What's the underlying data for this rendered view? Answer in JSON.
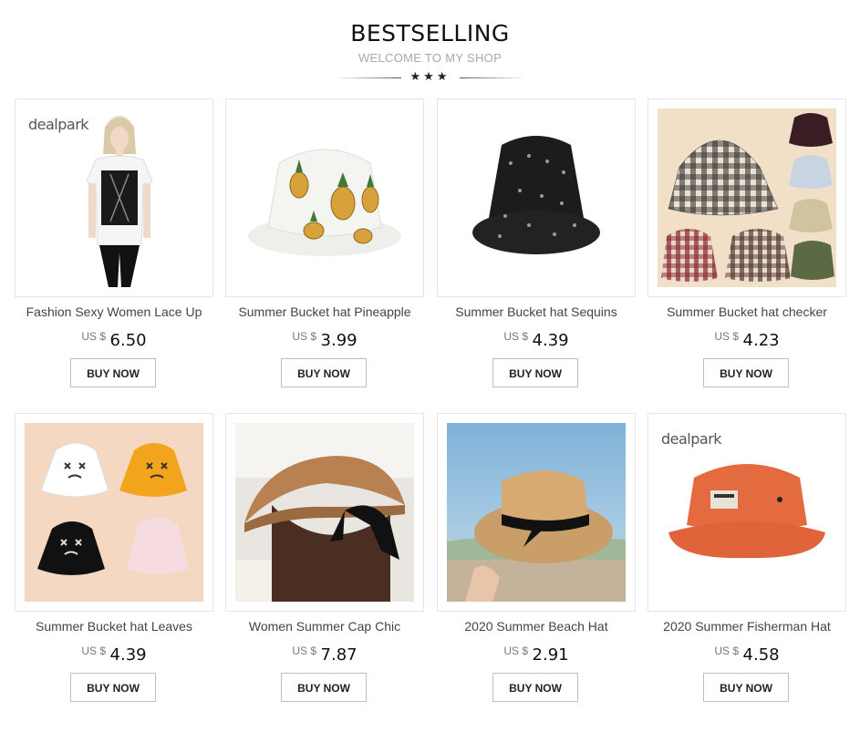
{
  "header": {
    "title": "BESTSELLING",
    "subtitle": "WELCOME TO MY SHOP",
    "stars": "★★★"
  },
  "currency": "US $",
  "buy_label": "BUY NOW",
  "brand_logo": "dealpark",
  "products": [
    {
      "name": "Fashion Sexy Women Lace Up",
      "price": "6.50",
      "image": "woman-corset-photo"
    },
    {
      "name": "Summer Bucket hat Pineapple",
      "price": "3.99",
      "image": "pineapple-bucket-hat"
    },
    {
      "name": "Summer Bucket hat Sequins",
      "price": "4.39",
      "image": "black-sequin-bucket-hat"
    },
    {
      "name": "Summer Bucket hat checker",
      "price": "4.23",
      "image": "plaid-bucket-hats"
    },
    {
      "name": "Summer Bucket hat Leaves",
      "price": "4.39",
      "image": "face-bucket-hats"
    },
    {
      "name": "Women Summer Cap Chic",
      "price": "7.87",
      "image": "straw-visor-hat"
    },
    {
      "name": "2020 Summer Beach Hat",
      "price": "2.91",
      "image": "straw-boater-hat"
    },
    {
      "name": "2020 Summer Fisherman Hat",
      "price": "4.58",
      "image": "orange-fisherman-hat"
    }
  ]
}
